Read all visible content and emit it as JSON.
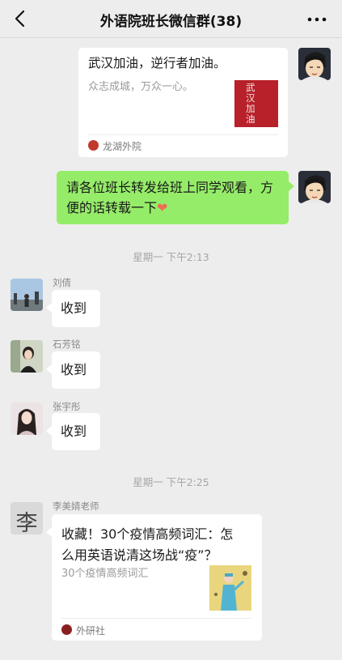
{
  "header": {
    "title": "外语院班长微信群(38)"
  },
  "messages": {
    "card1": {
      "title": "武汉加油，逆行者加油。",
      "desc": "众志成城，万众一心。",
      "thumb_text": "武汉加油",
      "source": "龙湖外院"
    },
    "self_text": "请各位班长转发给班上同学观看，方便的话转载一下",
    "self_emoji": "❤",
    "time1": "星期一 下午2:13",
    "replies": [
      {
        "name": "刘倩",
        "text": "收到"
      },
      {
        "name": "石芳铭",
        "text": "收到"
      },
      {
        "name": "张宇彤",
        "text": "收到"
      }
    ],
    "time2": "星期一 下午2:25",
    "teacher": {
      "name": "李美婧老师",
      "avatar_char": "李"
    },
    "card2": {
      "title_line1": "收藏！30个疫情高频词汇：怎",
      "title_line2": "么用英语说清这场战“疫”？",
      "desc": "30个疫情高频词汇",
      "source": "外研社"
    }
  },
  "colors": {
    "background": "#ededed",
    "self_bubble": "#95ec69",
    "heart": "#ef6d55"
  }
}
